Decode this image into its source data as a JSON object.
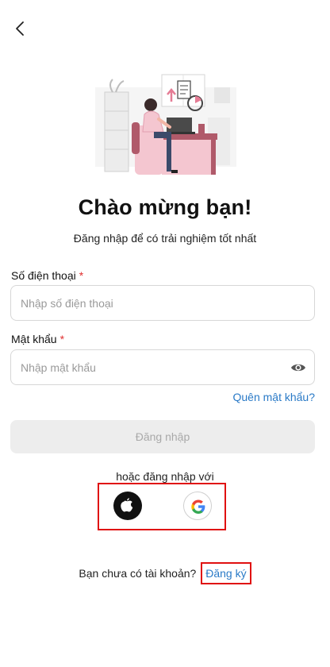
{
  "header": {
    "back_icon": "chevron-left-icon"
  },
  "hero": {
    "illustration": "person-working-at-desk-illustration",
    "title": "Chào mừng bạn!",
    "subtitle": "Đăng nhập để có trải nghiệm tốt nhất"
  },
  "form": {
    "phone": {
      "label": "Số điện thoại",
      "required_mark": "*",
      "placeholder": "Nhập số điện thoại",
      "value": ""
    },
    "password": {
      "label": "Mật khẩu",
      "required_mark": "*",
      "placeholder": "Nhập mật khẩu",
      "value": "",
      "toggle_icon": "eye-icon"
    },
    "forgot_label": "Quên mật khẩu?",
    "login_label": "Đăng nhập"
  },
  "social": {
    "divider_text": "hoặc đăng nhập với",
    "providers": [
      {
        "name": "apple",
        "icon": "apple-icon"
      },
      {
        "name": "google",
        "icon": "google-icon"
      }
    ]
  },
  "signup": {
    "prompt": "Bạn chưa có tài khoản?",
    "link_label": "Đăng ký"
  },
  "colors": {
    "accent_link": "#2a7ac7",
    "required": "#e03131",
    "highlight_box": "#e01010",
    "disabled_button_bg": "#ededed",
    "disabled_button_text": "#a9a9a9"
  }
}
